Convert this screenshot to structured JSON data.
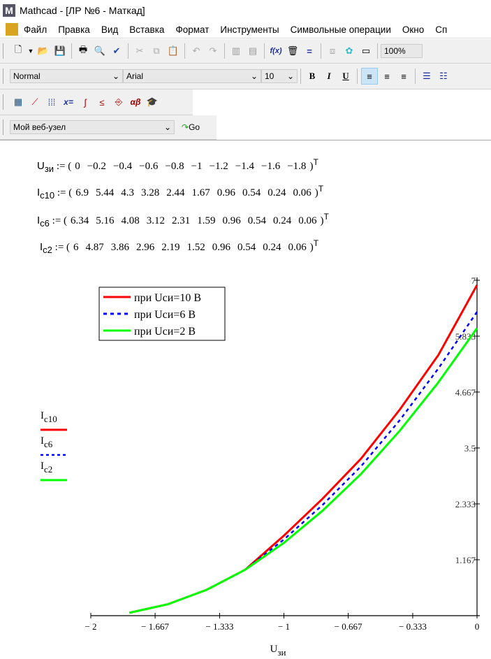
{
  "window": {
    "title": "Mathcad - [ЛР №6 - Маткад]"
  },
  "menu": [
    "Файл",
    "Правка",
    "Вид",
    "Вставка",
    "Формат",
    "Инструменты",
    "Символьные операции",
    "Окно",
    "Сп"
  ],
  "toolbar": {
    "zoom": "100%"
  },
  "format_bar": {
    "style": "Normal",
    "font": "Arial",
    "size": "10",
    "bold": "B",
    "italic": "I",
    "underline": "U"
  },
  "math_bar": {
    "eval": "x=",
    "greek": "αβ"
  },
  "web_bar": {
    "address": "Мой веб-узел",
    "go": "Go"
  },
  "equations": [
    {
      "name": "U",
      "sub": "зи",
      "assign": ":=",
      "values": [
        "0",
        "−0.2",
        "−0.4",
        "−0.6",
        "−0.8",
        "−1",
        "−1.2",
        "−1.4",
        "−1.6",
        "−1.8"
      ],
      "sup": "T"
    },
    {
      "name": "I",
      "sub": "c10",
      "assign": ":=",
      "values": [
        "6.9",
        "5.44",
        "4.3",
        "3.28",
        "2.44",
        "1.67",
        "0.96",
        "0.54",
        "0.24",
        "0.06"
      ],
      "sup": "T"
    },
    {
      "name": "I",
      "sub": "c6",
      "assign": ":=",
      "values": [
        "6.34",
        "5.16",
        "4.08",
        "3.12",
        "2.31",
        "1.59",
        "0.96",
        "0.54",
        "0.24",
        "0.06"
      ],
      "sup": "T"
    },
    {
      "name": "I",
      "sub": "c2",
      "assign": ":=",
      "values": [
        "6",
        "4.87",
        "3.86",
        "2.96",
        "2.19",
        "1.52",
        "0.96",
        "0.54",
        "0.24",
        "0.06"
      ],
      "sup": "T"
    }
  ],
  "chart_data": {
    "type": "line",
    "x": [
      0,
      -0.2,
      -0.4,
      -0.6,
      -0.8,
      -1,
      -1.2,
      -1.4,
      -1.6,
      -1.8
    ],
    "series": [
      {
        "name": "при Uси=10 В",
        "ylabel": "I",
        "ysub": "c10",
        "color": "#ff0000",
        "dash": false,
        "values": [
          6.9,
          5.44,
          4.3,
          3.28,
          2.44,
          1.67,
          0.96,
          0.54,
          0.24,
          0.06
        ]
      },
      {
        "name": "при Uси=6 В",
        "ylabel": "I",
        "ysub": "c6",
        "color": "#0000ff",
        "dash": true,
        "values": [
          6.34,
          5.16,
          4.08,
          3.12,
          2.31,
          1.59,
          0.96,
          0.54,
          0.24,
          0.06
        ]
      },
      {
        "name": "при Uси=2 В",
        "ylabel": "I",
        "ysub": "c2",
        "color": "#00ff00",
        "dash": false,
        "values": [
          6,
          4.87,
          3.86,
          2.96,
          2.19,
          1.52,
          0.96,
          0.54,
          0.24,
          0.06
        ]
      }
    ],
    "xlabel": "U",
    "xlabel_sub": "зи",
    "xlim": [
      -2,
      0
    ],
    "ylim": [
      0,
      7
    ],
    "xticks": [
      "− 2",
      "− 1.667",
      "− 1.333",
      "− 1",
      "− 0.667",
      "− 0.333",
      "0"
    ],
    "xtick_values": [
      -2,
      -1.667,
      -1.333,
      -1,
      -0.667,
      -0.333,
      0
    ],
    "yticks": [
      "1.167",
      "2.333",
      "3.5",
      "4.667",
      "5.833",
      "7"
    ],
    "ytick_values": [
      1.167,
      2.333,
      3.5,
      4.667,
      5.833,
      7
    ],
    "legend": "top-left"
  }
}
